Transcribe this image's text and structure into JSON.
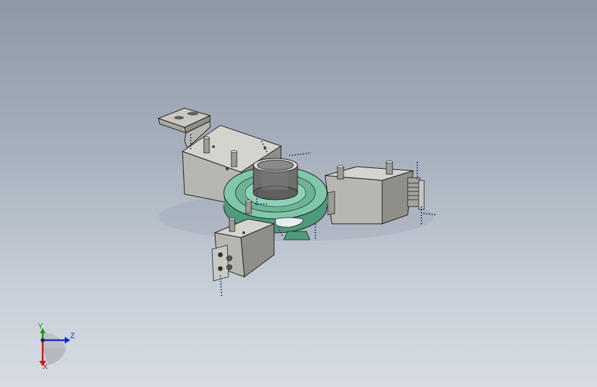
{
  "viewport": {
    "background_top": "#8d97a6",
    "background_bottom": "#d6dce2"
  },
  "colors": {
    "housing_fill": "#b8b6b0",
    "housing_side": "#8f8e89",
    "housing_top": "#d4d3ce",
    "bearing_green": "#7fc7a8",
    "bearing_dark": "#4f9a7c",
    "collar": "#6e6e6e",
    "edge": "#1e1e1e",
    "dimension_marks": "#1a2a70"
  },
  "triad": {
    "x_label": "X",
    "y_label": "Y",
    "z_label": "Z",
    "x_color": "#d01818",
    "y_color": "#1c9a1c",
    "z_color": "#1a2ad0"
  },
  "icons": {
    "model": "3d-assembly-icon",
    "triad": "coordinate-triad-icon"
  }
}
